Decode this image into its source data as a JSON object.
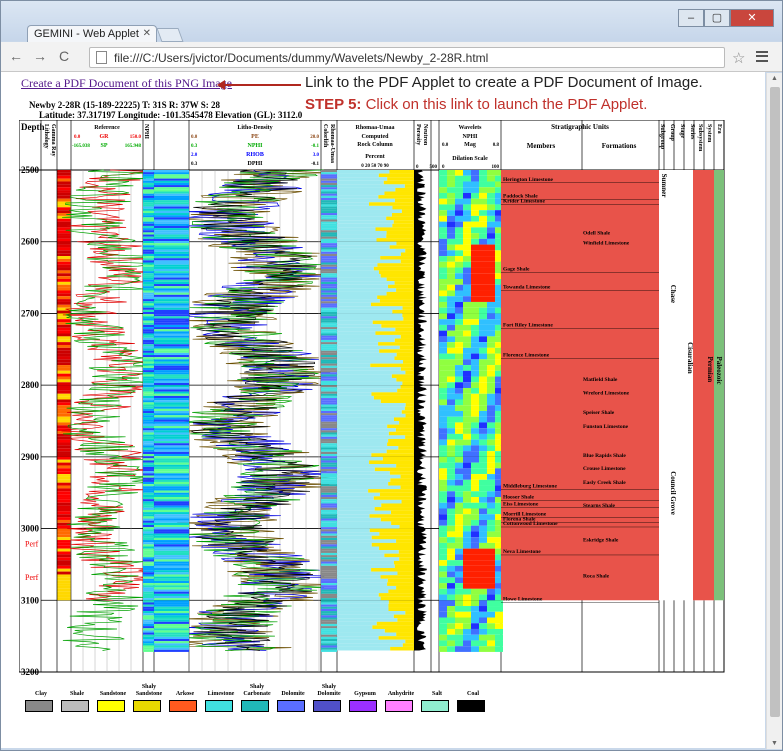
{
  "browser": {
    "tab_title": "GEMINI - Web Applet",
    "url": "file:///C:/Users/jvictor/Documents/dummy/Wavelets/Newby_2-28R.html"
  },
  "page": {
    "pdf_link": "Create a PDF Document of this PNG Image",
    "well_line1": "Newby 2-28R (15-189-22225) T: 31S R: 37W S: 28",
    "well_line2": "Latitude: 37.317197 Longitude: -101.3545478 Elevation (GL): 3112.0",
    "callout_line1": "Link to the PDF Applet to create a PDF Document of Image.",
    "callout_step": "STEP 5:",
    "callout_line2": " Click on this link to launch the PDF Applet."
  },
  "log": {
    "depth_label": "Depth",
    "depths": [
      "2500",
      "2600",
      "2700",
      "2800",
      "2900",
      "3000",
      "3100",
      "3200"
    ],
    "perf_labels": [
      "Perf",
      "Perf"
    ],
    "headers": {
      "lithology": "Lithology",
      "gamma": "Gamma Ray",
      "reference": "Reference",
      "gr": "GR",
      "sp": "SP",
      "gr_min": "0.0",
      "gr_max": "150.0",
      "sp_min": "-165.038",
      "sp_max": "165.948",
      "nphi": "NPHI",
      "lithodensity": "Litho-Density",
      "pe": "PE",
      "pe_min": "0.0",
      "pe_max": "20.0",
      "nphi2": "NPHI",
      "nphi_min": "0.3",
      "nphi_max": "-0.1",
      "rhob": "RHOB",
      "rhob_min": "2.0",
      "rhob_max": "3.0",
      "dphi": "DPHI",
      "dphi_min": "0.3",
      "dphi_max": "-0.1",
      "colorlith": "Colorlith",
      "rhomaa": "Rhomaa-Umaa",
      "computed": "Computed",
      "rock_column": "Rock Column",
      "percent": "Percent",
      "ticks": "0 20 50 70 90",
      "porosity": "Porosity",
      "neutron": "Neutron",
      "wavelets": "Wavelets",
      "nphi_mag": "NPHI",
      "mag": "Mag",
      "mag_min": "0.0",
      "mag_max": "0.8",
      "dilation": "Dilation Scale",
      "dil_min": "0",
      "dil_max": "100",
      "poro_min": "0",
      "poro_max": "500",
      "strat": "Stratigraphic Units",
      "members": "Members",
      "formations": "Formations",
      "subgroup": "Subgroup",
      "group": "Group",
      "stage": "Stage",
      "series": "Series",
      "subsystem": "Subsystem",
      "system": "System",
      "era": "Era"
    },
    "members": [
      "Herington Limestone",
      "Paddock Shale",
      "Krider Limestone",
      "Gage Shale",
      "Towanda Limestone",
      "Fort Riley Limestone",
      "Florence Limestone",
      "Middleburg Limestone",
      "Hooser Shale",
      "Eiss Limestone",
      "Morrill Limestone",
      "Florena Shale",
      "Cottonwood Limestone",
      "Neva Limestone",
      "Howe Limestone"
    ],
    "formations": [
      "Odell Shale",
      "Winfield Limestone",
      "Matfield Shale",
      "Wreford Limestone",
      "Speiser Shale",
      "Funston Limestone",
      "Blue Rapids Shale",
      "Crouse Limestone",
      "Easly Creek Shale",
      "Stearns Shale",
      "Eskridge Shale",
      "Roca Shale"
    ],
    "groups": [
      "Chase",
      "Council Grove"
    ],
    "subgroup": "Sumner",
    "series": "Cisuralian",
    "system": "Permian",
    "era": "Paleozoic"
  },
  "legend": [
    {
      "label": "Clay",
      "color": "#888888"
    },
    {
      "label": "Shale",
      "color": "#bbbbbb"
    },
    {
      "label": "Sandstone",
      "color": "#ffff00"
    },
    {
      "label": "Shaly Sandstone",
      "color": "#e8d800"
    },
    {
      "label": "Arkose",
      "color": "#ff5a1e"
    },
    {
      "label": "Limestone",
      "color": "#40e0e0"
    },
    {
      "label": "Shaly Carbonate",
      "color": "#20b8b8"
    },
    {
      "label": "Dolomite",
      "color": "#5a6eff"
    },
    {
      "label": "Shaly Dolomite",
      "color": "#5050c8"
    },
    {
      "label": "Gypsum",
      "color": "#9b30ff"
    },
    {
      "label": "Anhydrite",
      "color": "#ff80ff"
    },
    {
      "label": "Salt",
      "color": "#90eed0"
    },
    {
      "label": "Coal",
      "color": "#000000"
    }
  ],
  "colors": {
    "link": "#551a8b",
    "callout_red": "#c0312b",
    "strat_fill": "#e8534a",
    "era_fill": "#7cc07a"
  }
}
